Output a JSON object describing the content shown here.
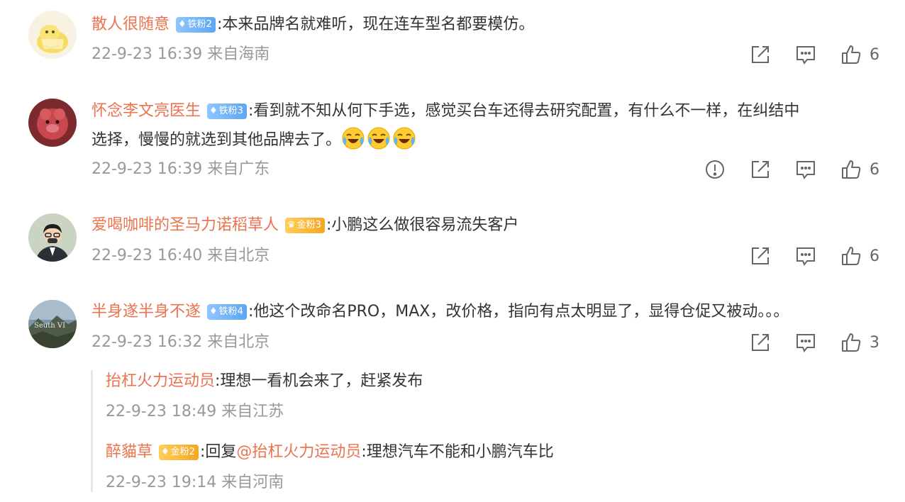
{
  "comments": [
    {
      "username": "散人很随意",
      "badge": "铁粉2",
      "text": ":本来品牌名就难听，现在连车型名都要模仿。",
      "timestamp": "22-9-23 16:39",
      "location": "来自海南",
      "likes": "6"
    },
    {
      "username": "怀念李文亮医生",
      "badge": "铁粉3",
      "text_line1": ":看到就不知从何下手选，感觉买台车还得去研究配置，有什么不一样，在纠结中",
      "text_line2": "选择，慢慢的就选到其他品牌去了。",
      "timestamp": "22-9-23 16:39",
      "location": "来自广东",
      "likes": "6",
      "emojis": [
        "laughing-crying-emoji",
        "laughing-crying-emoji",
        "laughing-crying-emoji"
      ]
    },
    {
      "username": "爱喝咖啡的圣马力诺稻草人",
      "badge": "金粉3",
      "text": ":小鹏这么做很容易流失客户",
      "timestamp": "22-9-23 16:40",
      "location": "来自北京",
      "likes": "6"
    },
    {
      "username": "半身遂半身不遂",
      "badge": "铁粉4",
      "text": ":他这个改命名PRO，MAX，改价格，指向有点太明显了，显得仓促又被动。。。",
      "timestamp": "22-9-23 16:32",
      "location": "来自北京",
      "likes": "3",
      "replies": [
        {
          "username": "抬杠火力运动员",
          "text": ":理想一看机会来了，赶紧发布",
          "timestamp": "22-9-23 18:49",
          "location": "来自江苏"
        },
        {
          "username": "醉貓草",
          "badge": "金粉2",
          "reply_prefix": ":回复",
          "mention": "@抬杠火力运动员",
          "text": ":理想汽车不能和小鹏汽车比",
          "timestamp": "22-9-23 19:14",
          "location": "来自河南"
        }
      ]
    }
  ],
  "icons": {
    "share": "share-icon",
    "comment": "comment-icon",
    "like": "thumbs-up-icon",
    "report": "report-icon"
  },
  "colors": {
    "username": "#eb7350",
    "meta": "#999999",
    "iron_badge": "#5ea5f2",
    "gold_badge": "#f5a623"
  }
}
